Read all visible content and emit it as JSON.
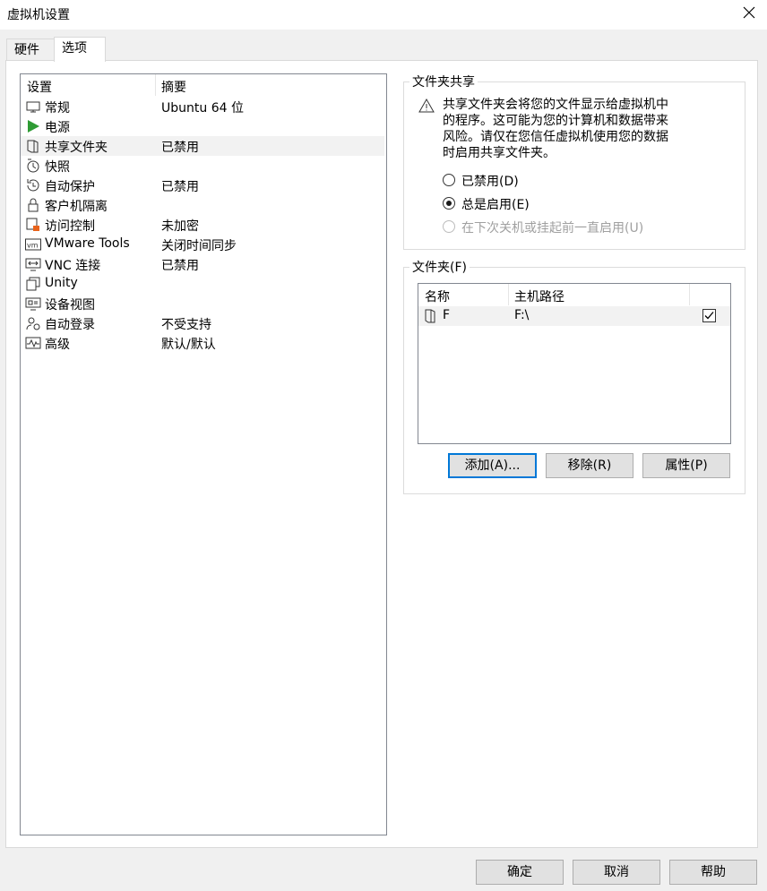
{
  "window": {
    "title": "虚拟机设置",
    "close_icon": "close-icon"
  },
  "tabs": [
    {
      "label": "硬件"
    },
    {
      "label": "选项"
    }
  ],
  "settings": {
    "header_setting": "设置",
    "header_summary": "摘要",
    "items": [
      {
        "label": "常规",
        "summary": "Ubuntu 64 位",
        "icon": "general-icon"
      },
      {
        "label": "电源",
        "summary": "",
        "icon": "power-icon"
      },
      {
        "label": "共享文件夹",
        "summary": "已禁用",
        "icon": "shared-folder-icon",
        "selected": true
      },
      {
        "label": "快照",
        "summary": "",
        "icon": "snapshot-icon"
      },
      {
        "label": "自动保护",
        "summary": "已禁用",
        "icon": "autoprotect-icon"
      },
      {
        "label": "客户机隔离",
        "summary": "",
        "icon": "lock-icon"
      },
      {
        "label": "访问控制",
        "summary": "未加密",
        "icon": "access-control-icon"
      },
      {
        "label": "VMware Tools",
        "summary": "关闭时间同步",
        "icon": "vmware-tools-icon"
      },
      {
        "label": "VNC 连接",
        "summary": "已禁用",
        "icon": "vnc-icon"
      },
      {
        "label": "Unity",
        "summary": "",
        "icon": "unity-icon"
      },
      {
        "label": "设备视图",
        "summary": "",
        "icon": "device-view-icon"
      },
      {
        "label": "自动登录",
        "summary": "不受支持",
        "icon": "autologin-icon"
      },
      {
        "label": "高级",
        "summary": "默认/默认",
        "icon": "advanced-icon"
      }
    ]
  },
  "folder_sharing": {
    "title": "文件夹共享",
    "warning_lines": [
      "共享文件夹会将您的文件显示给虚拟机中",
      "的程序。这可能为您的计算机和数据带来",
      "风险。请仅在您信任虚拟机使用您的数据",
      "时启用共享文件夹。"
    ],
    "options": [
      {
        "label": "已禁用(D)",
        "checked": false,
        "disabled": false
      },
      {
        "label": "总是启用(E)",
        "checked": true,
        "disabled": false
      },
      {
        "label": "在下次关机或挂起前一直启用(U)",
        "checked": false,
        "disabled": true
      }
    ]
  },
  "folders": {
    "title": "文件夹(F)",
    "col_name": "名称",
    "col_path": "主机路径",
    "rows": [
      {
        "name": "F",
        "path": "F:\\",
        "enabled": true
      }
    ],
    "add_label": "添加(A)...",
    "remove_label": "移除(R)",
    "props_label": "属性(P)"
  },
  "footer": {
    "ok_label": "确定",
    "cancel_label": "取消",
    "help_label": "帮助"
  }
}
